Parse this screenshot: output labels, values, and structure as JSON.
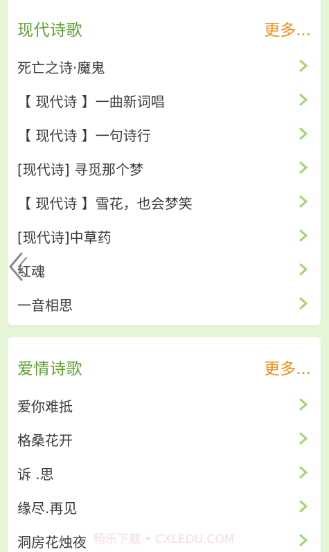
{
  "sections": [
    {
      "title": "现代诗歌",
      "more": "更多...",
      "items": [
        "死亡之诗·魔鬼",
        "【 现代诗 】一曲新词唱",
        "【 现代诗 】一句诗行",
        "[现代诗] 寻觅那个梦",
        "【 现代诗 】雪花，也会梦笑",
        "[现代诗]中草药",
        "红魂",
        "一音相思"
      ]
    },
    {
      "title": "爱情诗歌",
      "more": "更多...",
      "items": [
        "爱你难抵",
        "格桑花开",
        "诉 .思",
        "缘尽.再见",
        "洞房花烛夜"
      ]
    }
  ],
  "watermark": "畅乐下载 • CXLEDU.COM",
  "icons": {
    "chevron": "chevron-right-icon",
    "back": "back-arrow-icon"
  },
  "colors": {
    "background": "#e6f7d8",
    "title": "#5ca12e",
    "more": "#f08f18",
    "chevron": "#9fd66f",
    "text": "#3b3b3b"
  }
}
